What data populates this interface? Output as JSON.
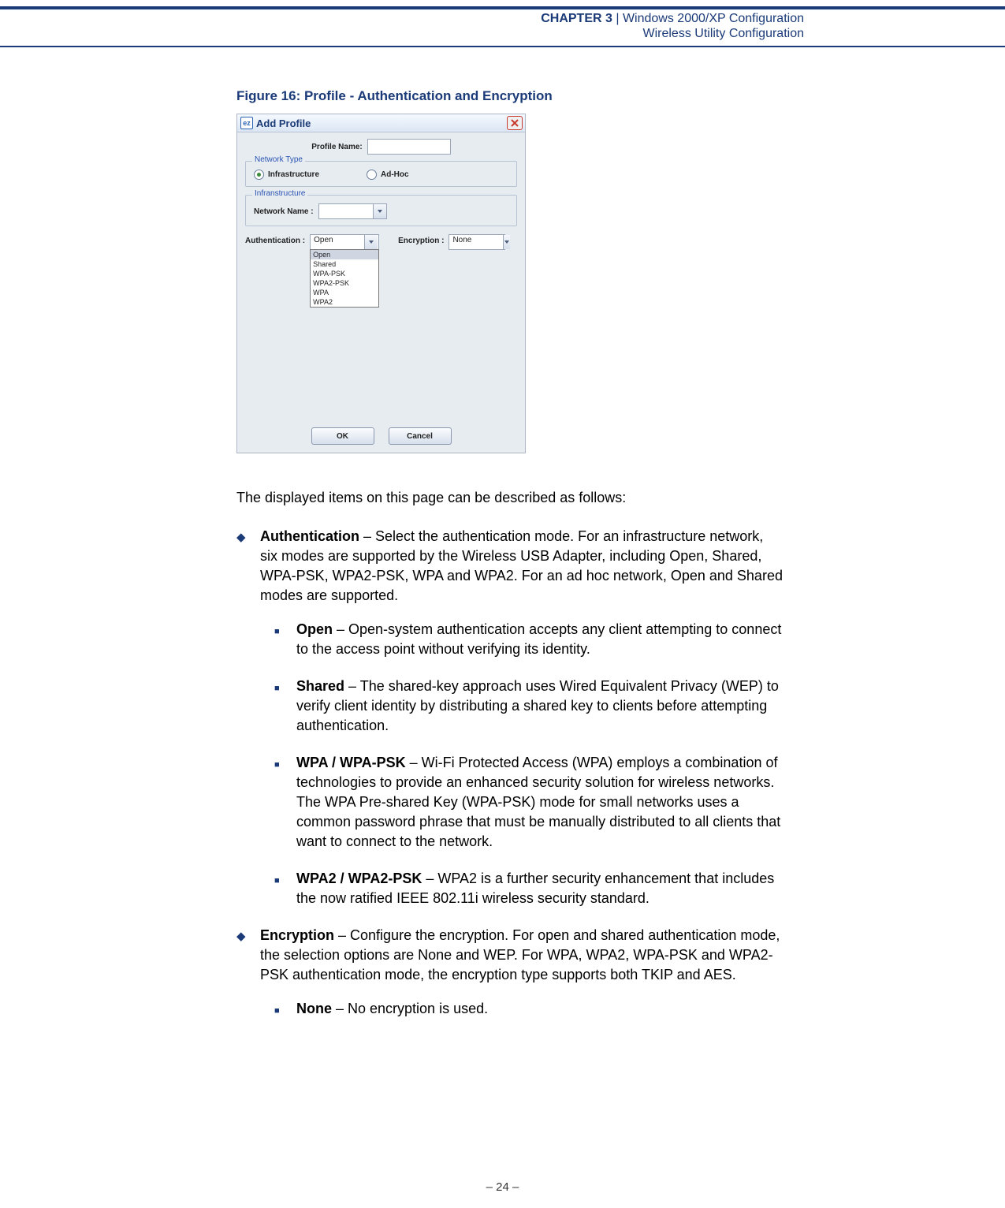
{
  "header": {
    "chapter": "CHAPTER 3",
    "sep": "  |  ",
    "title_line1": "Windows 2000/XP Configuration",
    "title_line2": "Wireless Utility Configuration"
  },
  "figure": {
    "caption": "Figure 16:  Profile - Authentication and Encryption"
  },
  "dialog": {
    "title_icon": "ez",
    "title": "Add Profile",
    "profile_name_label": "Profile Name:",
    "profile_name_value": "",
    "network_type_legend": "Network Type",
    "radio_infra": "Infrastructure",
    "radio_adhoc": "Ad-Hoc",
    "infra_legend": "Infranstructure",
    "network_name_label": "Network Name :",
    "network_name_value": "",
    "auth_label": "Authentication :",
    "auth_value": "Open",
    "auth_options": [
      "Open",
      "Shared",
      "WPA-PSK",
      "WPA2-PSK",
      "WPA",
      "WPA2"
    ],
    "enc_label": "Encryption :",
    "enc_value": "None",
    "ok": "OK",
    "cancel": "Cancel"
  },
  "body": {
    "intro": "The displayed items on this page can be described as follows:",
    "items": [
      {
        "term": "Authentication",
        "text": " – Select the authentication mode. For an infrastructure network, six modes are supported by the Wireless USB Adapter, including Open, Shared, WPA-PSK, WPA2-PSK, WPA and WPA2. For an ad hoc network, Open and Shared modes are supported.",
        "sub": [
          {
            "term": "Open",
            "text": " – Open-system authentication accepts any client attempting to connect to the access point without verifying its identity."
          },
          {
            "term": "Shared",
            "text": " – The shared-key approach uses Wired Equivalent Privacy (WEP) to verify client identity by distributing a shared key to clients before attempting authentication."
          },
          {
            "term": "WPA / WPA-PSK",
            "text": " – Wi-Fi Protected Access (WPA) employs a combination of technologies to provide an enhanced security solution for wireless networks. The WPA Pre-shared Key (WPA-PSK) mode for small networks uses a common password phrase that must be manually distributed to all clients that want to connect to the network."
          },
          {
            "term": "WPA2 / WPA2-PSK",
            "text": " – WPA2 is a further security enhancement that includes the now ratified IEEE 802.11i wireless security standard."
          }
        ]
      },
      {
        "term": "Encryption",
        "text": " – Configure the encryption. For open and shared authentication mode, the selection options are None and WEP. For WPA, WPA2, WPA-PSK and WPA2-PSK authentication mode, the encryption type supports both TKIP and AES.",
        "sub": [
          {
            "term": "None",
            "text": " – No encryption is used."
          }
        ]
      }
    ]
  },
  "footer": "–  24  –"
}
